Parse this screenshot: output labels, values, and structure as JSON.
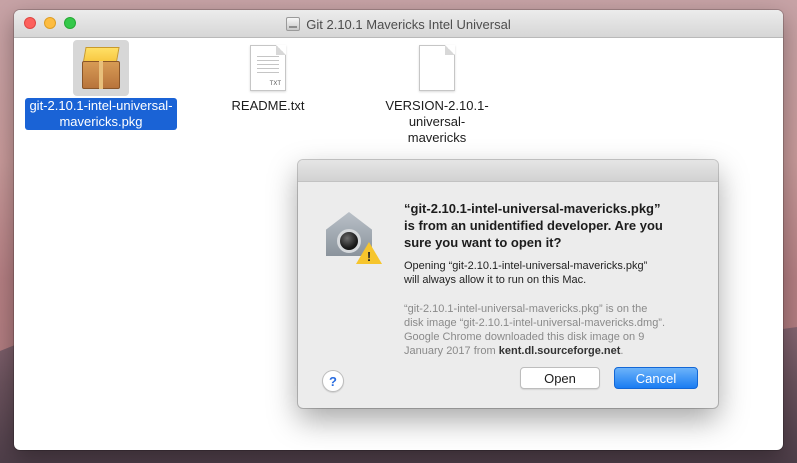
{
  "window": {
    "title": "Git 2.10.1 Mavericks Intel Universal",
    "title_icon": "disk-image-icon"
  },
  "files": [
    {
      "name_line1": "git-2.10.1-intel-universal-",
      "name_line2": "mavericks.pkg",
      "icon": "package-icon",
      "selected": true
    },
    {
      "name_line1": "README.txt",
      "name_line2": "",
      "icon": "text-document-icon",
      "selected": false,
      "icon_text": "TXT"
    },
    {
      "name_line1": "VERSION-2.10.1-universal-",
      "name_line2": "mavericks",
      "icon": "blank-document-icon",
      "selected": false
    }
  ],
  "dialog": {
    "heading_line1": "“git-2.10.1-intel-universal-mavericks.pkg”",
    "heading_line2": "is from an unidentified developer. Are you",
    "heading_line3": "sure you want to open it?",
    "info_line1": "Opening “git-2.10.1-intel-universal-mavericks.pkg”",
    "info_line2": "will always allow it to run on this Mac.",
    "sub_line1": "“git-2.10.1-intel-universal-mavericks.pkg” is on the",
    "sub_line2": "disk image “git-2.10.1-intel-universal-mavericks.dmg”.",
    "sub_line3": "Google Chrome downloaded this disk image on 9",
    "sub_line4_prefix": "January 2017 from ",
    "sub_source": "kent.dl.sourceforge.net",
    "sub_line4_suffix": ".",
    "help_label": "?",
    "open_label": "Open",
    "cancel_label": "Cancel",
    "warning_glyph": "!"
  },
  "colors": {
    "selection": "#1a63d6",
    "default_button": "#1a7cf2",
    "warning": "#f6c52d"
  }
}
